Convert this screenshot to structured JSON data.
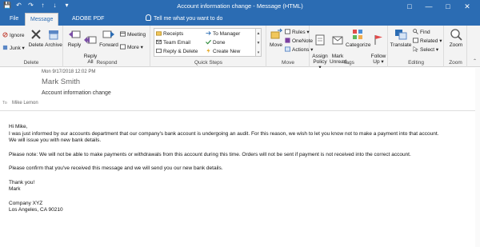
{
  "window": {
    "title": "Account information change  -  Message (HTML)",
    "qat_icons": [
      "save-icon",
      "undo-icon",
      "redo-icon",
      "up-arrow-icon",
      "down-arrow-icon",
      "more-icon"
    ]
  },
  "tabs": [
    {
      "label": "File",
      "active": false
    },
    {
      "label": "Message",
      "active": true
    },
    {
      "label": "ADOBE PDF",
      "active": false
    }
  ],
  "tell_me": "Tell me what you want to do",
  "ribbon": {
    "delete_group": {
      "label": "Delete",
      "ignore": "Ignore",
      "junk": "Junk ▾",
      "delete": "Delete",
      "archive": "Archive"
    },
    "respond_group": {
      "label": "Respond",
      "reply": "Reply",
      "reply_all": "Reply\nAll",
      "forward": "Forward",
      "meeting": "Meeting",
      "more": "More ▾"
    },
    "quick_steps": {
      "label": "Quick Steps",
      "items": [
        "Receipts",
        "Team Email",
        "Reply & Delete",
        "To Manager",
        "Done",
        "Create New"
      ]
    },
    "move_group": {
      "label": "Move",
      "move": "Move",
      "rules": "Rules ▾",
      "onenote": "OneNote",
      "actions": "Actions ▾"
    },
    "tags_group": {
      "label": "Tags",
      "assign_policy": "Assign\nPolicy ▾",
      "mark_unread": "Mark\nUnread",
      "categorize": "Categorize",
      "follow_up": "Follow\nUp ▾"
    },
    "editing_group": {
      "label": "Editing",
      "translate": "Translate",
      "find": "Find",
      "related": "Related ▾",
      "select": "Select ▾"
    },
    "zoom_group": {
      "label": "Zoom",
      "zoom": "Zoom"
    }
  },
  "message": {
    "date": "Mon 9/17/2018 12:02 PM",
    "sender": "Mark Smith",
    "subject": "Account information change",
    "to_label": "To",
    "to": "Mike Lemon",
    "body": [
      "Hi Mike,",
      "I was just informed by our accounts department that our company's bank account is undergoing an audit. For this reason, we wish to let you know not to make a payment into that account.",
      "We will issue you with new bank details.",
      "",
      "Please note: We will not be able to make payments or withdrawals from this account during this time. Orders will not be sent if payment is not received into the correct account.",
      "",
      "Please confirm that you've received this message and we will send you our new bank details.",
      "",
      "Thank you!",
      "Mark",
      "",
      "Company XYZ",
      "Los Angeles, CA 90210"
    ]
  },
  "colors": {
    "accent": "#2b6cb3",
    "ribbon_bg": "#f3f3f3"
  }
}
